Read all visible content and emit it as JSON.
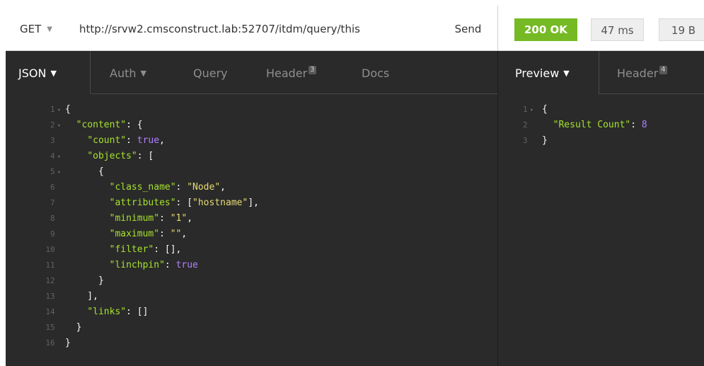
{
  "request": {
    "method": "GET",
    "url": "http://srvw2.cmsconstruct.lab:52707/itdm/query/this",
    "send_label": "Send"
  },
  "response": {
    "status": "200 OK",
    "time": "47 ms",
    "size": "19 B"
  },
  "request_tabs": [
    {
      "label": "JSON",
      "badge": "",
      "active": true
    },
    {
      "label": "Auth",
      "badge": "",
      "active": false
    },
    {
      "label": "Query",
      "badge": "",
      "active": false
    },
    {
      "label": "Header",
      "badge": "3",
      "active": false
    },
    {
      "label": "Docs",
      "badge": "",
      "active": false
    }
  ],
  "response_tabs": [
    {
      "label": "Preview",
      "badge": "",
      "active": true
    },
    {
      "label": "Header",
      "badge": "4",
      "active": false
    }
  ],
  "request_body": {
    "line_numbers": [
      "1",
      "2",
      "3",
      "4",
      "5",
      "6",
      "7",
      "8",
      "9",
      "10",
      "11",
      "12",
      "13",
      "14",
      "15",
      "16"
    ],
    "foldable_lines": [
      "1",
      "2",
      "4",
      "5"
    ],
    "lines": [
      [
        {
          "t": "{",
          "c": "p"
        }
      ],
      [
        {
          "t": "  ",
          "c": "p"
        },
        {
          "t": "\"content\"",
          "c": "k"
        },
        {
          "t": ": {",
          "c": "p"
        }
      ],
      [
        {
          "t": "    ",
          "c": "p"
        },
        {
          "t": "\"count\"",
          "c": "k"
        },
        {
          "t": ": ",
          "c": "p"
        },
        {
          "t": "true",
          "c": "b"
        },
        {
          "t": ",",
          "c": "p"
        }
      ],
      [
        {
          "t": "    ",
          "c": "p"
        },
        {
          "t": "\"objects\"",
          "c": "k"
        },
        {
          "t": ": [",
          "c": "p"
        }
      ],
      [
        {
          "t": "      {",
          "c": "p"
        }
      ],
      [
        {
          "t": "        ",
          "c": "p"
        },
        {
          "t": "\"class_name\"",
          "c": "k"
        },
        {
          "t": ": ",
          "c": "p"
        },
        {
          "t": "\"Node\"",
          "c": "s"
        },
        {
          "t": ",",
          "c": "p"
        }
      ],
      [
        {
          "t": "        ",
          "c": "p"
        },
        {
          "t": "\"attributes\"",
          "c": "k"
        },
        {
          "t": ": [",
          "c": "p"
        },
        {
          "t": "\"hostname\"",
          "c": "s"
        },
        {
          "t": "],",
          "c": "p"
        }
      ],
      [
        {
          "t": "        ",
          "c": "p"
        },
        {
          "t": "\"minimum\"",
          "c": "k"
        },
        {
          "t": ": ",
          "c": "p"
        },
        {
          "t": "\"1\"",
          "c": "s"
        },
        {
          "t": ",",
          "c": "p"
        }
      ],
      [
        {
          "t": "        ",
          "c": "p"
        },
        {
          "t": "\"maximum\"",
          "c": "k"
        },
        {
          "t": ": ",
          "c": "p"
        },
        {
          "t": "\"\"",
          "c": "s"
        },
        {
          "t": ",",
          "c": "p"
        }
      ],
      [
        {
          "t": "        ",
          "c": "p"
        },
        {
          "t": "\"filter\"",
          "c": "k"
        },
        {
          "t": ": [],",
          "c": "p"
        }
      ],
      [
        {
          "t": "        ",
          "c": "p"
        },
        {
          "t": "\"linchpin\"",
          "c": "k"
        },
        {
          "t": ": ",
          "c": "p"
        },
        {
          "t": "true",
          "c": "b"
        }
      ],
      [
        {
          "t": "      }",
          "c": "p"
        }
      ],
      [
        {
          "t": "    ],",
          "c": "p"
        }
      ],
      [
        {
          "t": "    ",
          "c": "p"
        },
        {
          "t": "\"links\"",
          "c": "k"
        },
        {
          "t": ": []",
          "c": "p"
        }
      ],
      [
        {
          "t": "  }",
          "c": "p"
        }
      ],
      [
        {
          "t": "}",
          "c": "p"
        }
      ]
    ]
  },
  "response_body": {
    "line_numbers": [
      "1",
      "2",
      "3"
    ],
    "foldable_lines": [
      "1"
    ],
    "lines": [
      [
        {
          "t": "{",
          "c": "p"
        }
      ],
      [
        {
          "t": "  ",
          "c": "p"
        },
        {
          "t": "\"Result Count\"",
          "c": "k"
        },
        {
          "t": ": ",
          "c": "p"
        },
        {
          "t": "8",
          "c": "n"
        }
      ],
      [
        {
          "t": "}",
          "c": "p"
        }
      ]
    ]
  },
  "icons": {
    "dropdown": "chevron-down-icon",
    "fold": "fold-arrow-icon"
  },
  "colors": {
    "status_ok": "#75ba24",
    "editor_bg": "#2a2a2a",
    "json_key": "#a6e22e",
    "json_string": "#e6db74",
    "json_literal": "#ae81ff"
  }
}
